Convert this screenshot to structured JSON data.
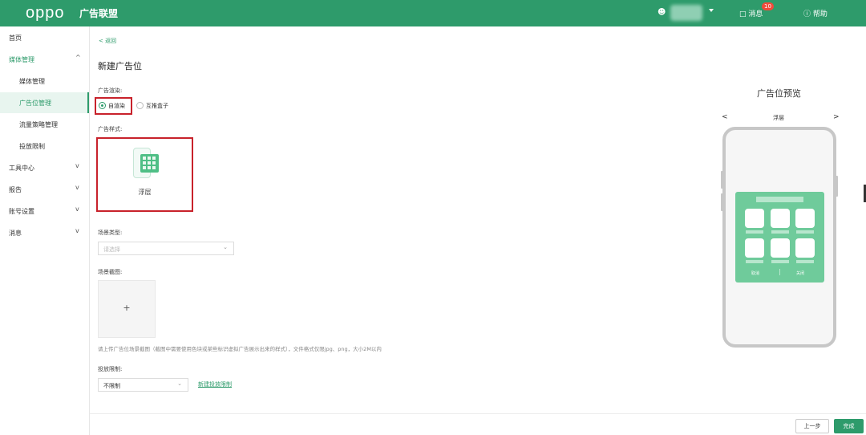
{
  "header": {
    "logo": "oppo",
    "brand": "广告联盟",
    "user_icon": "user-icon",
    "messages_label": "消息",
    "messages_badge": "10",
    "help_label": "帮助",
    "accent": "#2e9b6b"
  },
  "sidebar": {
    "items": [
      {
        "label": "首页"
      },
      {
        "label": "媒体管理",
        "chevron": "^"
      },
      {
        "label": "媒体管理"
      },
      {
        "label": "广告位管理"
      },
      {
        "label": "流量策略管理"
      },
      {
        "label": "投放限制"
      },
      {
        "label": "工具中心",
        "chevron": "v"
      },
      {
        "label": "报告",
        "chevron": "v"
      },
      {
        "label": "账号设置",
        "chevron": "v"
      },
      {
        "label": "消息",
        "chevron": "v"
      }
    ]
  },
  "main": {
    "back_label": "< 返回",
    "title": "新建广告位",
    "render_label": "广告渲染:",
    "render_options": [
      "自渲染",
      "互推盒子"
    ],
    "style_label": "广告样式:",
    "style_card_label": "浮层",
    "scene_type_label": "场景类型:",
    "scene_type_placeholder": "请选择",
    "screenshot_label": "场景截图:",
    "upload_plus": "+",
    "upload_hint": "请上传广告位场景截图（截图中需要使用色块或某些标识虚拟广告展示出来的样式），文件格式仅限jpg、png，大小2M以内",
    "limit_label": "投放限制:",
    "limit_value": "不限制",
    "new_limit_link": "新建投放限制"
  },
  "footer": {
    "prev_label": "上一步",
    "done_label": "完成"
  },
  "preview": {
    "title": "广告位预览",
    "prev_arrow": "<",
    "next_arrow": ">",
    "style_name": "浮层",
    "cancel_label": "取消",
    "close_label": "关闭"
  }
}
